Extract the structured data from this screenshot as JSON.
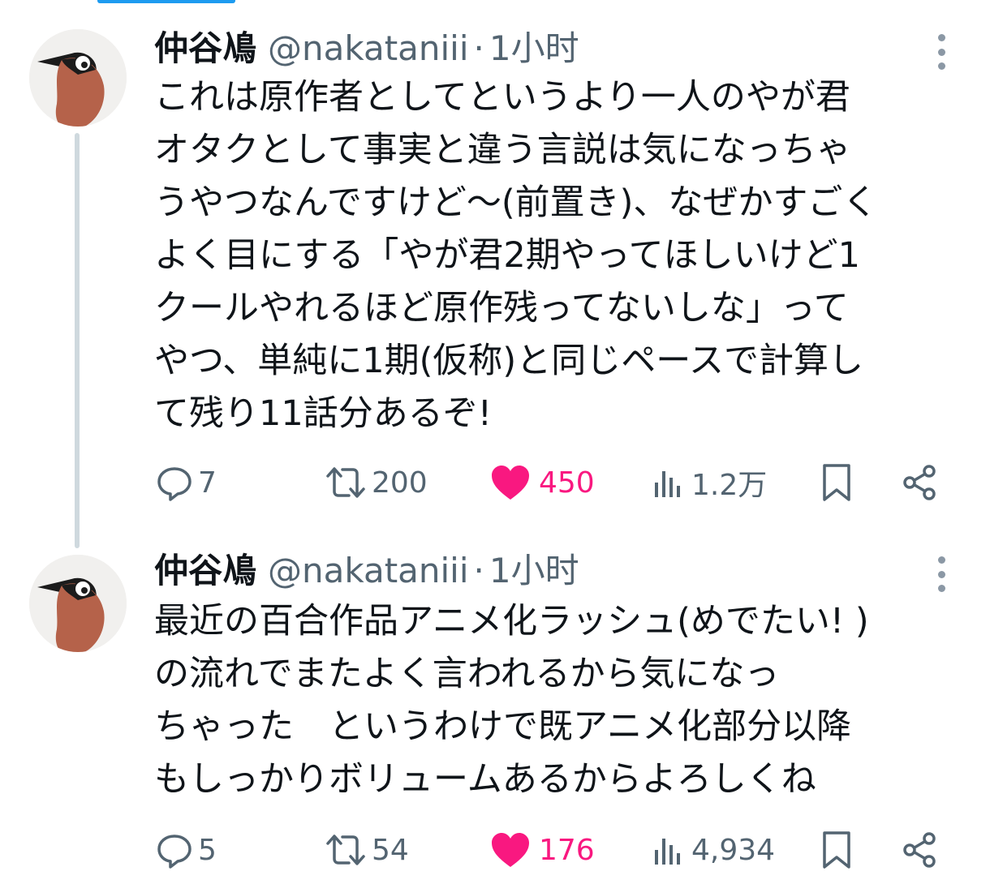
{
  "colors": {
    "like": "#f91880",
    "muted": "#536471",
    "text": "#0f1419",
    "accent": "#1d9bf0"
  },
  "tweets": [
    {
      "author": {
        "name": "仲谷鳰",
        "handle": "@nakataniii"
      },
      "separator": "·",
      "time": "1小时",
      "text": "これは原作者としてというより一人のやが君\nオタクとして事実と違う言説は気になっちゃ\nうやつなんですけど〜(前置き)、なぜかすごく\nよく目にする「やが君2期やってほしいけど1\nクールやれるほど原作残ってないしな」って\nやつ、単純に1期(仮称)と同じペースで計算し\nて残り11話分あるぞ!",
      "stats": {
        "replies": "7",
        "retweets": "200",
        "likes": "450",
        "views": "1.2万"
      },
      "icons": [
        "reply-icon",
        "retweet-icon",
        "heart-icon",
        "views-icon",
        "bookmark-icon",
        "share-icon"
      ]
    },
    {
      "author": {
        "name": "仲谷鳰",
        "handle": "@nakataniii"
      },
      "separator": "·",
      "time": "1小时",
      "text": "最近の百合作品アニメ化ラッシュ(めでたい! )\nの流れでまたよく言われるから気になっ\nちゃった　というわけで既アニメ化部分以降\nもしっかりボリュームあるからよろしくね",
      "stats": {
        "replies": "5",
        "retweets": "54",
        "likes": "176",
        "views": "4,934"
      },
      "icons": [
        "reply-icon",
        "retweet-icon",
        "heart-icon",
        "views-icon",
        "bookmark-icon",
        "share-icon"
      ]
    }
  ]
}
